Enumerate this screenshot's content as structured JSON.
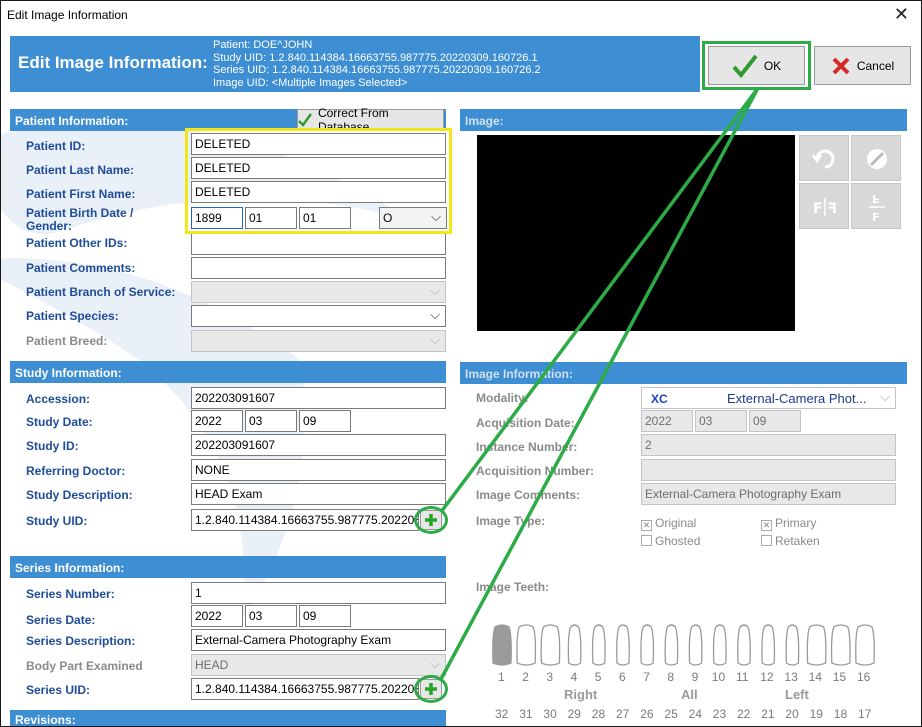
{
  "window": {
    "title": "Edit Image Information",
    "close_glyph": "✕"
  },
  "banner": {
    "title": "Edit Image Information:",
    "patient": "Patient: DOE^JOHN",
    "study_uid": "Study UID: 1.2.840.114384.16663755.987775.20220309.160726.1",
    "series_uid": "Series UID: 1.2.840.114384.16663755.987775.20220309.160726.2",
    "image_uid": "Image UID: <Multiple Images Selected>"
  },
  "buttons": {
    "ok": "OK",
    "cancel": "Cancel",
    "correct_db": "Correct From Database"
  },
  "patient": {
    "header": "Patient Information:",
    "labels": {
      "id": "Patient ID:",
      "last": "Patient Last Name:",
      "first": "Patient First Name:",
      "birth1": "Patient Birth Date /",
      "birth2": "Gender:",
      "other_ids": "Patient Other IDs:",
      "comments": "Patient Comments:",
      "branch": "Patient Branch of Service:",
      "species": "Patient Species:",
      "breed": "Patient Breed:"
    },
    "values": {
      "id": "DELETED",
      "last": "DELETED",
      "first": "DELETED",
      "birth_year": "1899",
      "birth_month": "01",
      "birth_day": "01",
      "gender": "O",
      "other_ids": "",
      "comments": "",
      "branch": "",
      "species": "",
      "breed": ""
    }
  },
  "study": {
    "header": "Study Information:",
    "labels": {
      "accession": "Accession:",
      "date": "Study Date:",
      "id": "Study ID:",
      "doctor": "Referring Doctor:",
      "desc": "Study Description:",
      "uid": "Study UID:"
    },
    "values": {
      "accession": "202203091607",
      "year": "2022",
      "month": "03",
      "day": "09",
      "id": "202203091607",
      "doctor": "NONE",
      "desc": "HEAD Exam",
      "uid": "1.2.840.114384.16663755.987775.20220309"
    }
  },
  "series": {
    "header": "Series Information:",
    "labels": {
      "number": "Series Number:",
      "date": "Series Date:",
      "desc": "Series Description:",
      "body": "Body Part Examined",
      "uid": "Series UID:"
    },
    "values": {
      "number": "1",
      "year": "2022",
      "month": "03",
      "day": "09",
      "desc": "External-Camera Photography Exam",
      "body": "HEAD",
      "uid": "1.2.840.114384.16663755.987775.20220309"
    }
  },
  "revisions": {
    "header": "Revisions:"
  },
  "image": {
    "header": "Image:"
  },
  "image_info": {
    "header": "Image Information:",
    "labels": {
      "modality": "Modality:",
      "acq_date": "Acquisition Date:",
      "instance": "Instance Number:",
      "acq_number": "Acquisition Number:",
      "comments": "Image Comments:",
      "type": "Image Type:",
      "teeth": "Image Teeth:"
    },
    "values": {
      "modality_code": "XC",
      "modality_name": "External-Camera Phot...",
      "year": "2022",
      "month": "03",
      "day": "09",
      "instance": "2",
      "acq_number": "",
      "comments": "External-Camera Photography Exam"
    },
    "type_options": {
      "original": "Original",
      "primary": "Primary",
      "ghosted": "Ghosted",
      "retaken": "Retaken"
    }
  },
  "teeth": {
    "upper": [
      "1",
      "2",
      "3",
      "4",
      "5",
      "6",
      "7",
      "8",
      "9",
      "10",
      "11",
      "12",
      "13",
      "14",
      "15",
      "16"
    ],
    "lower": [
      "32",
      "31",
      "30",
      "29",
      "28",
      "27",
      "26",
      "25",
      "24",
      "23",
      "22",
      "21",
      "20",
      "19",
      "18",
      "17"
    ],
    "right": "Right",
    "all": "All",
    "left": "Left"
  },
  "colors": {
    "accent": "#3d8ed2",
    "label": "#1e4c9a",
    "highlight_yellow": "#f2e616",
    "highlight_green": "#2cab46"
  }
}
